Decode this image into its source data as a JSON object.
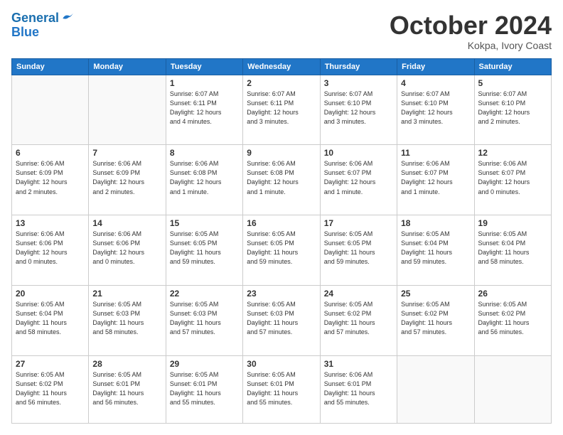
{
  "header": {
    "logo_line1": "General",
    "logo_line2": "Blue",
    "month": "October 2024",
    "location": "Kokpa, Ivory Coast"
  },
  "days_of_week": [
    "Sunday",
    "Monday",
    "Tuesday",
    "Wednesday",
    "Thursday",
    "Friday",
    "Saturday"
  ],
  "weeks": [
    [
      {
        "day": "",
        "info": ""
      },
      {
        "day": "",
        "info": ""
      },
      {
        "day": "1",
        "info": "Sunrise: 6:07 AM\nSunset: 6:11 PM\nDaylight: 12 hours\nand 4 minutes."
      },
      {
        "day": "2",
        "info": "Sunrise: 6:07 AM\nSunset: 6:11 PM\nDaylight: 12 hours\nand 3 minutes."
      },
      {
        "day": "3",
        "info": "Sunrise: 6:07 AM\nSunset: 6:10 PM\nDaylight: 12 hours\nand 3 minutes."
      },
      {
        "day": "4",
        "info": "Sunrise: 6:07 AM\nSunset: 6:10 PM\nDaylight: 12 hours\nand 3 minutes."
      },
      {
        "day": "5",
        "info": "Sunrise: 6:07 AM\nSunset: 6:10 PM\nDaylight: 12 hours\nand 2 minutes."
      }
    ],
    [
      {
        "day": "6",
        "info": "Sunrise: 6:06 AM\nSunset: 6:09 PM\nDaylight: 12 hours\nand 2 minutes."
      },
      {
        "day": "7",
        "info": "Sunrise: 6:06 AM\nSunset: 6:09 PM\nDaylight: 12 hours\nand 2 minutes."
      },
      {
        "day": "8",
        "info": "Sunrise: 6:06 AM\nSunset: 6:08 PM\nDaylight: 12 hours\nand 1 minute."
      },
      {
        "day": "9",
        "info": "Sunrise: 6:06 AM\nSunset: 6:08 PM\nDaylight: 12 hours\nand 1 minute."
      },
      {
        "day": "10",
        "info": "Sunrise: 6:06 AM\nSunset: 6:07 PM\nDaylight: 12 hours\nand 1 minute."
      },
      {
        "day": "11",
        "info": "Sunrise: 6:06 AM\nSunset: 6:07 PM\nDaylight: 12 hours\nand 1 minute."
      },
      {
        "day": "12",
        "info": "Sunrise: 6:06 AM\nSunset: 6:07 PM\nDaylight: 12 hours\nand 0 minutes."
      }
    ],
    [
      {
        "day": "13",
        "info": "Sunrise: 6:06 AM\nSunset: 6:06 PM\nDaylight: 12 hours\nand 0 minutes."
      },
      {
        "day": "14",
        "info": "Sunrise: 6:06 AM\nSunset: 6:06 PM\nDaylight: 12 hours\nand 0 minutes."
      },
      {
        "day": "15",
        "info": "Sunrise: 6:05 AM\nSunset: 6:05 PM\nDaylight: 11 hours\nand 59 minutes."
      },
      {
        "day": "16",
        "info": "Sunrise: 6:05 AM\nSunset: 6:05 PM\nDaylight: 11 hours\nand 59 minutes."
      },
      {
        "day": "17",
        "info": "Sunrise: 6:05 AM\nSunset: 6:05 PM\nDaylight: 11 hours\nand 59 minutes."
      },
      {
        "day": "18",
        "info": "Sunrise: 6:05 AM\nSunset: 6:04 PM\nDaylight: 11 hours\nand 59 minutes."
      },
      {
        "day": "19",
        "info": "Sunrise: 6:05 AM\nSunset: 6:04 PM\nDaylight: 11 hours\nand 58 minutes."
      }
    ],
    [
      {
        "day": "20",
        "info": "Sunrise: 6:05 AM\nSunset: 6:04 PM\nDaylight: 11 hours\nand 58 minutes."
      },
      {
        "day": "21",
        "info": "Sunrise: 6:05 AM\nSunset: 6:03 PM\nDaylight: 11 hours\nand 58 minutes."
      },
      {
        "day": "22",
        "info": "Sunrise: 6:05 AM\nSunset: 6:03 PM\nDaylight: 11 hours\nand 57 minutes."
      },
      {
        "day": "23",
        "info": "Sunrise: 6:05 AM\nSunset: 6:03 PM\nDaylight: 11 hours\nand 57 minutes."
      },
      {
        "day": "24",
        "info": "Sunrise: 6:05 AM\nSunset: 6:02 PM\nDaylight: 11 hours\nand 57 minutes."
      },
      {
        "day": "25",
        "info": "Sunrise: 6:05 AM\nSunset: 6:02 PM\nDaylight: 11 hours\nand 57 minutes."
      },
      {
        "day": "26",
        "info": "Sunrise: 6:05 AM\nSunset: 6:02 PM\nDaylight: 11 hours\nand 56 minutes."
      }
    ],
    [
      {
        "day": "27",
        "info": "Sunrise: 6:05 AM\nSunset: 6:02 PM\nDaylight: 11 hours\nand 56 minutes."
      },
      {
        "day": "28",
        "info": "Sunrise: 6:05 AM\nSunset: 6:01 PM\nDaylight: 11 hours\nand 56 minutes."
      },
      {
        "day": "29",
        "info": "Sunrise: 6:05 AM\nSunset: 6:01 PM\nDaylight: 11 hours\nand 55 minutes."
      },
      {
        "day": "30",
        "info": "Sunrise: 6:05 AM\nSunset: 6:01 PM\nDaylight: 11 hours\nand 55 minutes."
      },
      {
        "day": "31",
        "info": "Sunrise: 6:06 AM\nSunset: 6:01 PM\nDaylight: 11 hours\nand 55 minutes."
      },
      {
        "day": "",
        "info": ""
      },
      {
        "day": "",
        "info": ""
      }
    ]
  ]
}
